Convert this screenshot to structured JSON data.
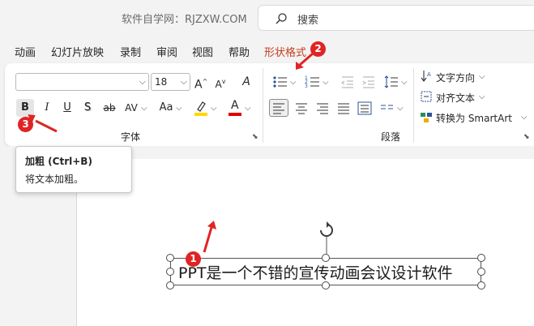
{
  "titlebar": {
    "site": "软件自学网：RJZXW.COM",
    "search_label": "搜索"
  },
  "tabs": [
    {
      "label": "动画"
    },
    {
      "label": "幻灯片放映"
    },
    {
      "label": "录制"
    },
    {
      "label": "审阅"
    },
    {
      "label": "视图"
    },
    {
      "label": "帮助"
    },
    {
      "label": "形状格式",
      "active": true
    }
  ],
  "font_group": {
    "label": "字体",
    "font_name": "",
    "font_size": "18",
    "grow_label": "A",
    "shrink_label": "A",
    "clear_label": "A",
    "bold": "B",
    "italic": "I",
    "underline": "U",
    "shadow": "S",
    "strike": "ab",
    "spacing": "AV",
    "case": "Aa",
    "font_color": "A"
  },
  "paragraph_group": {
    "label": "段落",
    "text_direction": "文字方向",
    "align_text": "对齐文本",
    "smartart": "转换为 SmartArt"
  },
  "tooltip": {
    "title": "加粗 (Ctrl+B)",
    "desc": "将文本加粗。"
  },
  "slide": {
    "text": "PPT是一个不错的宣传动画会议设计软件"
  },
  "annotations": [
    {
      "label": "1"
    },
    {
      "label": "2"
    },
    {
      "label": "3"
    }
  ],
  "colors": {
    "accent": "#c43e1c",
    "badge": "#e02424",
    "highlight": "#ffd800",
    "font_color": "#e00000"
  }
}
